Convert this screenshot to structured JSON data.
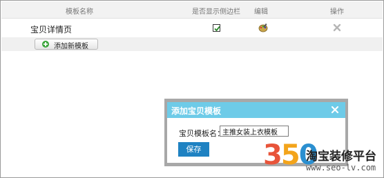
{
  "table": {
    "headers": {
      "name": "模板名称",
      "show_sidebar": "是否显示侧边栏",
      "edit": "编辑",
      "operations": "操作"
    },
    "rows": [
      {
        "name": "宝贝详情页",
        "show_sidebar": true
      }
    ]
  },
  "add_template_button": {
    "label": "添加新模板",
    "icon": "plus-icon"
  },
  "modal": {
    "title": "添加宝贝模板",
    "close_icon": "close-icon",
    "field_label": "宝贝模板名：",
    "field_value": "主推女装上衣模板",
    "save_label": "保存"
  },
  "watermark": {
    "number": "350",
    "name": "淘宝装修平台",
    "url": "www.seo-lv.com"
  },
  "colors": {
    "modal_header": "#6ecbe8",
    "save_button": "#1f82c2",
    "logo_red": "#e8543a",
    "logo_orange": "#f3a41b",
    "logo_blue": "#2b8fd0"
  }
}
